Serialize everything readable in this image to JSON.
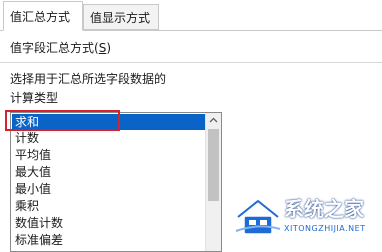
{
  "tabs": [
    {
      "label": "值汇总方式",
      "active": true
    },
    {
      "label": "值显示方式",
      "active": false
    }
  ],
  "summarize_by": {
    "label_prefix": "值字段汇总方式(",
    "accelerator": "S",
    "label_suffix": ")"
  },
  "instruction": "选择用于汇总所选字段数据的",
  "calc_type_label": "计算类型",
  "list": {
    "selected": "求和",
    "items": [
      "求和",
      "计数",
      "平均值",
      "最大值",
      "最小值",
      "乘积",
      "数值计数",
      "标准偏差"
    ]
  },
  "watermark": {
    "title": "系统之家",
    "url": "XITONGZHIJIA.NET"
  },
  "colors": {
    "selection": "#0a64c8",
    "highlight_border": "#d4232f"
  }
}
